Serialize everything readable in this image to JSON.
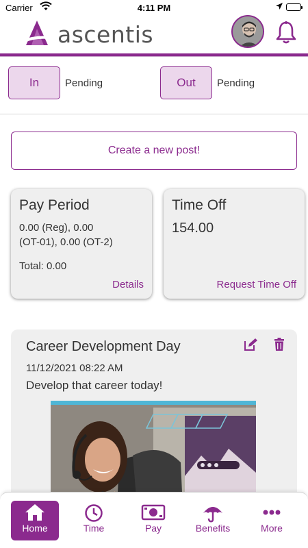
{
  "status_bar": {
    "carrier": "Carrier",
    "time": "4:11 PM"
  },
  "header": {
    "logo_text": "ascentis",
    "logo_icon": "ascentis-logo-icon",
    "avatar": "user-avatar",
    "bell_icon": "bell-icon"
  },
  "clock": {
    "in_label": "In",
    "in_status": "Pending",
    "out_label": "Out",
    "out_status": "Pending"
  },
  "create_post": "Create a new post!",
  "pay_period": {
    "title": "Pay Period",
    "line1": "0.00 (Reg), 0.00",
    "line2": "(OT-01), 0.00 (OT-2)",
    "total": "Total: 0.00",
    "link": "Details"
  },
  "time_off": {
    "title": "Time Off",
    "value": "154.00",
    "link": "Request Time Off"
  },
  "post": {
    "title": "Career Development Day",
    "date": "11/12/2021 08:22 AM",
    "text": "Develop that career today!",
    "edit_icon": "pencil-icon",
    "delete_icon": "trash-icon"
  },
  "tabs": [
    {
      "label": "Home",
      "icon": "home-icon"
    },
    {
      "label": "Time",
      "icon": "clock-icon"
    },
    {
      "label": "Pay",
      "icon": "money-icon"
    },
    {
      "label": "Benefits",
      "icon": "umbrella-icon"
    },
    {
      "label": "More",
      "icon": "more-icon"
    }
  ],
  "colors": {
    "accent": "#8b2a8e",
    "accent_light": "#ecd7ec",
    "card_bg": "#efefef"
  }
}
